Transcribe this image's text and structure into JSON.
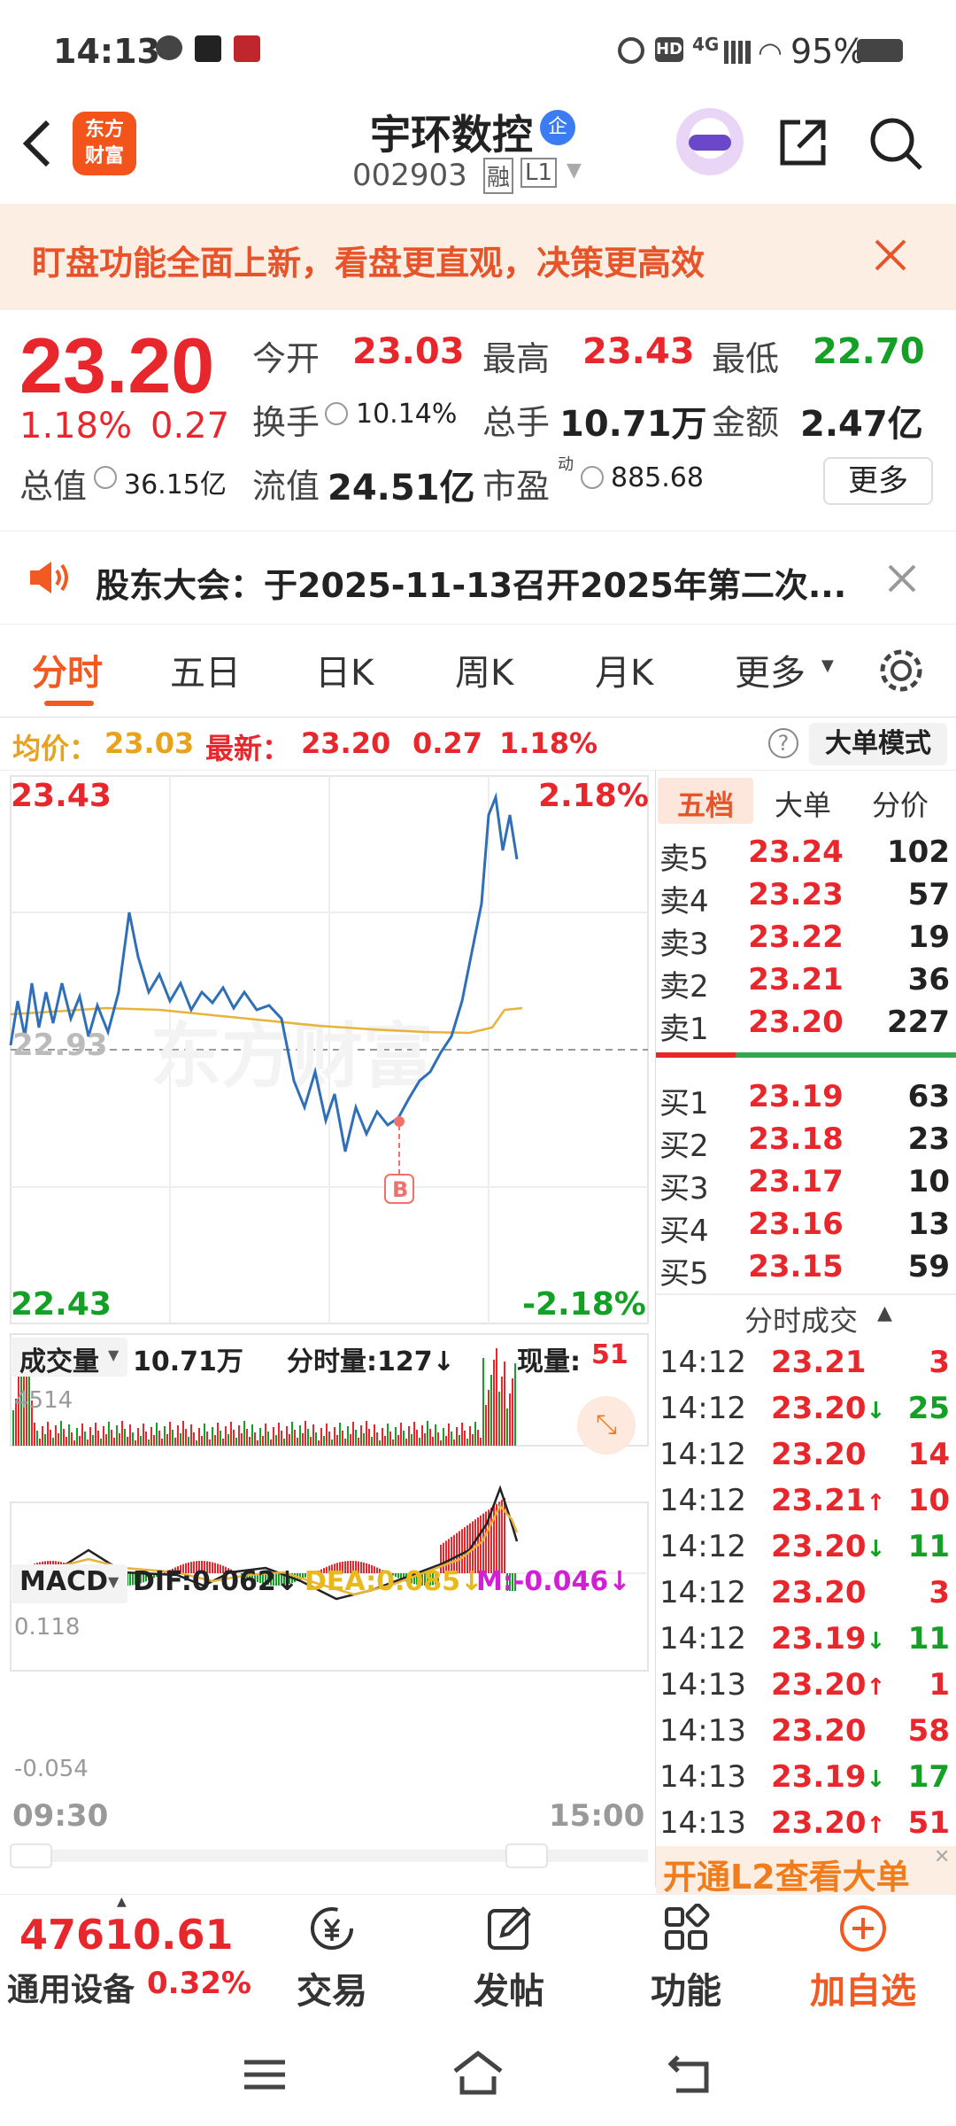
{
  "status": {
    "time": "14:13",
    "battery": "95%",
    "network": "4G"
  },
  "header": {
    "title": "宇环数控",
    "code": "002903",
    "badge_rong": "融",
    "badge_l1": "L1",
    "logo_line1": "东方",
    "logo_line2": "财富",
    "tag": "企"
  },
  "banner": {
    "text": "盯盘功能全面上新，看盘更直观，决策更高效"
  },
  "quote": {
    "price": "23.20",
    "change_pct": "1.18%",
    "change": "0.27",
    "open_label": "今开",
    "open": "23.03",
    "high_label": "最高",
    "high": "23.43",
    "low_label": "最低",
    "low": "22.70",
    "turnover_label": "换手",
    "turnover": "10.14%",
    "volume_label": "总手",
    "volume": "10.71万",
    "amount_label": "金额",
    "amount": "2.47亿",
    "mcap_label": "总值",
    "mcap": "36.15亿",
    "float_label": "流值",
    "float": "24.51亿",
    "pe_label": "市盈",
    "pe_sup": "动",
    "pe": "885.68",
    "more": "更多"
  },
  "notice": {
    "text": "股东大会：于2025-11-13召开2025年第二次..."
  },
  "tabs": [
    "分时",
    "五日",
    "日K",
    "周K",
    "月K",
    "更多"
  ],
  "infobar": {
    "avg_label": "均价：",
    "avg": "23.03",
    "last_label": "最新：",
    "last": "23.20",
    "chg": "0.27",
    "pct": "1.18%",
    "mode": "大单模式"
  },
  "chart": {
    "high": "23.43",
    "high_pct": "2.18%",
    "low": "22.43",
    "low_pct": "-2.18%",
    "prev": "22.93",
    "marker": "B",
    "vol_label": "成交量",
    "vol_total": "10.71万",
    "minute_vol": "分时量:127↓",
    "cur_vol_label": "现量:",
    "cur_vol": "51",
    "vol_max": "4514",
    "macd_label": "MACD",
    "dif": "DIF:0.062↓",
    "dea": "DEA:0.085↓",
    "m": "M:-0.046↓",
    "macd_max": "0.118",
    "macd_min": "-0.054",
    "start_time": "09:30",
    "end_time": "15:00",
    "watermark": "东方财富"
  },
  "book": {
    "tabs": [
      "五档",
      "大单",
      "分价"
    ],
    "sells": [
      {
        "l": "卖5",
        "p": "23.24",
        "v": "102"
      },
      {
        "l": "卖4",
        "p": "23.23",
        "v": "57"
      },
      {
        "l": "卖3",
        "p": "23.22",
        "v": "19"
      },
      {
        "l": "卖2",
        "p": "23.21",
        "v": "36"
      },
      {
        "l": "卖1",
        "p": "23.20",
        "v": "227"
      }
    ],
    "buys": [
      {
        "l": "买1",
        "p": "23.19",
        "v": "63"
      },
      {
        "l": "买2",
        "p": "23.18",
        "v": "23"
      },
      {
        "l": "买3",
        "p": "23.17",
        "v": "10"
      },
      {
        "l": "买4",
        "p": "23.16",
        "v": "13"
      },
      {
        "l": "买5",
        "p": "23.15",
        "v": "59"
      }
    ],
    "trades_title": "分时成交",
    "trades": [
      {
        "t": "14:12",
        "p": "23.21",
        "v": "3",
        "a": ""
      },
      {
        "t": "14:12",
        "p": "23.20",
        "v": "25",
        "a": "↓"
      },
      {
        "t": "14:12",
        "p": "23.20",
        "v": "14",
        "a": ""
      },
      {
        "t": "14:12",
        "p": "23.21",
        "v": "10",
        "a": "↑"
      },
      {
        "t": "14:12",
        "p": "23.20",
        "v": "11",
        "a": "↓"
      },
      {
        "t": "14:12",
        "p": "23.20",
        "v": "3",
        "a": ""
      },
      {
        "t": "14:12",
        "p": "23.19",
        "v": "11",
        "a": "↓"
      },
      {
        "t": "14:13",
        "p": "23.20",
        "v": "1",
        "a": "↑"
      },
      {
        "t": "14:13",
        "p": "23.20",
        "v": "58",
        "a": ""
      },
      {
        "t": "14:13",
        "p": "23.19",
        "v": "17",
        "a": "↓"
      },
      {
        "t": "14:13",
        "p": "23.20",
        "v": "51",
        "a": "↑"
      }
    ],
    "l2": "开通L2查看大单"
  },
  "bottom": {
    "index_value": "47610.61",
    "index_name": "通用设备",
    "index_pct": "0.32%",
    "trade": "交易",
    "post": "发帖",
    "func": "功能",
    "add": "加自选"
  }
}
